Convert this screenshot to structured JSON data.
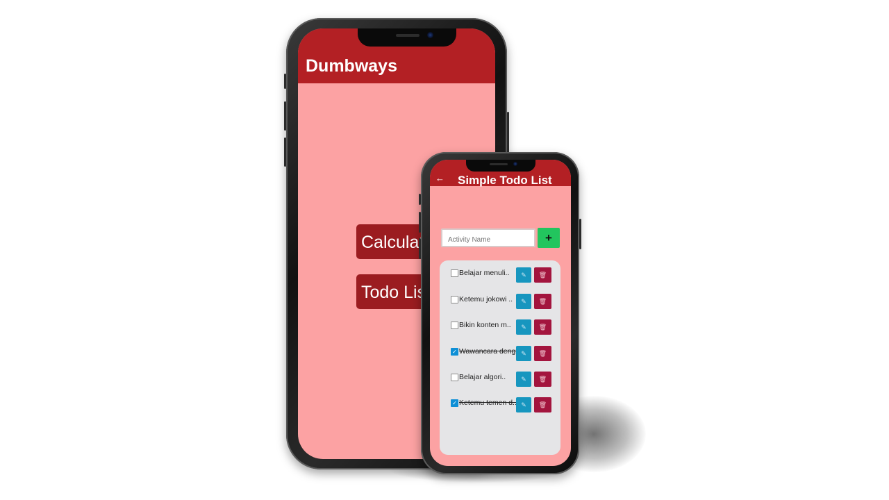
{
  "app_a": {
    "title": "Dumbways",
    "buttons": [
      {
        "label": "Calculator"
      },
      {
        "label": "Todo List"
      }
    ]
  },
  "app_b": {
    "title": "Simple Todo List",
    "back_icon": "arrow-left-icon",
    "input_placeholder": "Activity Name",
    "add_label": "+",
    "todos": [
      {
        "text": "Belajar menuli..",
        "done": false
      },
      {
        "text": "Ketemu jokowi ..",
        "done": false
      },
      {
        "text": "Bikin konten m..",
        "done": false
      },
      {
        "text": "Wawancara deng..",
        "done": true
      },
      {
        "text": "Belajar algori..",
        "done": false
      },
      {
        "text": "Ketemu temen d..",
        "done": true
      }
    ],
    "edit_icon": "pencil-icon",
    "delete_icon": "trash-icon"
  },
  "colors": {
    "appbar": "#b32024",
    "screen_bg": "#fca2a3",
    "menu_button": "#9b1c20",
    "add_button": "#22c55e",
    "edit_button": "#1796bf",
    "delete_button": "#a3153e",
    "card_bg": "#e5e5e7"
  }
}
